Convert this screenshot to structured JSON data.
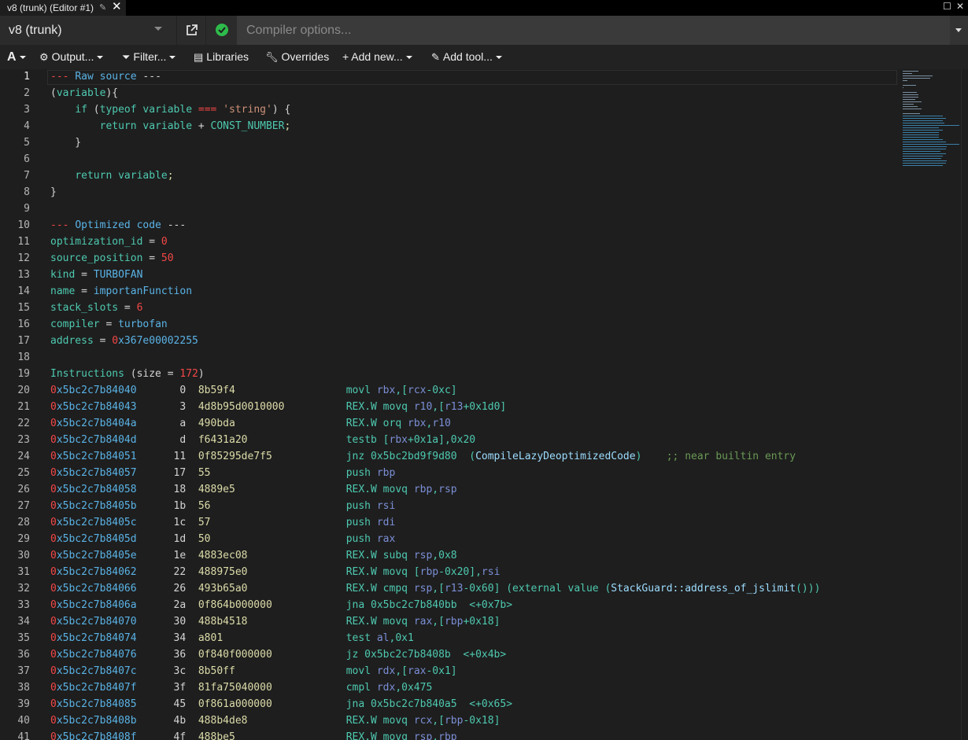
{
  "tab": {
    "title": "v8 (trunk) (Editor #1)"
  },
  "compiler": {
    "name": "v8 (trunk)",
    "options_placeholder": "Compiler options..."
  },
  "toolbar": {
    "font_label": "A",
    "output_label": "Output...",
    "filter_label": "Filter...",
    "libraries_label": "Libraries",
    "overrides_label": "Overrides",
    "add_new_label": "+ Add new...",
    "add_tool_label": "Add tool..."
  },
  "colors": {
    "background": "#1e1e1e",
    "status_ok": "#2ebb4b",
    "keyword": "#4ec9b0",
    "string": "#ce9178",
    "number": "#f44747",
    "register": "#7b8fd6",
    "comment": "#6a9955"
  },
  "icons": {
    "popout": "external-link-icon",
    "status": "check-circle-icon",
    "output": "gear-icon",
    "filter": "funnel-icon",
    "libraries": "book-icon",
    "overrides": "wrench-icon",
    "add_tool": "brush-icon"
  },
  "code": {
    "raw_source_header": "Raw source",
    "source_lines": [
      "(variable){",
      "    if (typeof variable === 'string') {",
      "        return variable + CONST_NUMBER;",
      "    }",
      "",
      "    return variable;",
      "}"
    ],
    "optimized_header": "Optimized code",
    "meta": [
      {
        "key": "optimization_id",
        "value": "0"
      },
      {
        "key": "source_position",
        "value": "50"
      },
      {
        "key": "kind",
        "value": "TURBOFAN"
      },
      {
        "key": "name",
        "value": "importanFunction"
      },
      {
        "key": "stack_slots",
        "value": "6"
      },
      {
        "key": "compiler",
        "value": "turbofan"
      },
      {
        "key": "address",
        "value": "0x367e00002255"
      }
    ],
    "instructions_size": "172",
    "instructions": [
      {
        "addr": "0x5bc2c7b84040",
        "off": "0",
        "bytes": "8b59f4",
        "asm": "movl rbx,[rcx-0xc]"
      },
      {
        "addr": "0x5bc2c7b84043",
        "off": "3",
        "bytes": "4d8b95d0010000",
        "asm": "REX.W movq r10,[r13+0x1d0]"
      },
      {
        "addr": "0x5bc2c7b8404a",
        "off": "a",
        "bytes": "490bda",
        "asm": "REX.W orq rbx,r10"
      },
      {
        "addr": "0x5bc2c7b8404d",
        "off": "d",
        "bytes": "f6431a20",
        "asm": "testb [rbx+0x1a],0x20"
      },
      {
        "addr": "0x5bc2c7b84051",
        "off": "11",
        "bytes": "0f85295de7f5",
        "asm": "jnz 0x5bc2bd9f9d80  (CompileLazyDeoptimizedCode)    ;; near builtin entry"
      },
      {
        "addr": "0x5bc2c7b84057",
        "off": "17",
        "bytes": "55",
        "asm": "push rbp"
      },
      {
        "addr": "0x5bc2c7b84058",
        "off": "18",
        "bytes": "4889e5",
        "asm": "REX.W movq rbp,rsp"
      },
      {
        "addr": "0x5bc2c7b8405b",
        "off": "1b",
        "bytes": "56",
        "asm": "push rsi"
      },
      {
        "addr": "0x5bc2c7b8405c",
        "off": "1c",
        "bytes": "57",
        "asm": "push rdi"
      },
      {
        "addr": "0x5bc2c7b8405d",
        "off": "1d",
        "bytes": "50",
        "asm": "push rax"
      },
      {
        "addr": "0x5bc2c7b8405e",
        "off": "1e",
        "bytes": "4883ec08",
        "asm": "REX.W subq rsp,0x8"
      },
      {
        "addr": "0x5bc2c7b84062",
        "off": "22",
        "bytes": "488975e0",
        "asm": "REX.W movq [rbp-0x20],rsi"
      },
      {
        "addr": "0x5bc2c7b84066",
        "off": "26",
        "bytes": "493b65a0",
        "asm": "REX.W cmpq rsp,[r13-0x60] (external value (StackGuard::address_of_jslimit()))"
      },
      {
        "addr": "0x5bc2c7b8406a",
        "off": "2a",
        "bytes": "0f864b000000",
        "asm": "jna 0x5bc2c7b840bb  <+0x7b>"
      },
      {
        "addr": "0x5bc2c7b84070",
        "off": "30",
        "bytes": "488b4518",
        "asm": "REX.W movq rax,[rbp+0x18]"
      },
      {
        "addr": "0x5bc2c7b84074",
        "off": "34",
        "bytes": "a801",
        "asm": "test al,0x1"
      },
      {
        "addr": "0x5bc2c7b84076",
        "off": "36",
        "bytes": "0f840f000000",
        "asm": "jz 0x5bc2c7b8408b  <+0x4b>"
      },
      {
        "addr": "0x5bc2c7b8407c",
        "off": "3c",
        "bytes": "8b50ff",
        "asm": "movl rdx,[rax-0x1]"
      },
      {
        "addr": "0x5bc2c7b8407f",
        "off": "3f",
        "bytes": "81fa75040000",
        "asm": "cmpl rdx,0x475"
      },
      {
        "addr": "0x5bc2c7b84085",
        "off": "45",
        "bytes": "0f861a000000",
        "asm": "jna 0x5bc2c7b840a5  <+0x65>"
      },
      {
        "addr": "0x5bc2c7b8408b",
        "off": "4b",
        "bytes": "488b4de8",
        "asm": "REX.W movq rcx,[rbp-0x18]"
      },
      {
        "addr": "0x5bc2c7b8408f",
        "off": "4f",
        "bytes": "488be5",
        "asm": "REX.W movq rsp,rbp"
      }
    ]
  }
}
